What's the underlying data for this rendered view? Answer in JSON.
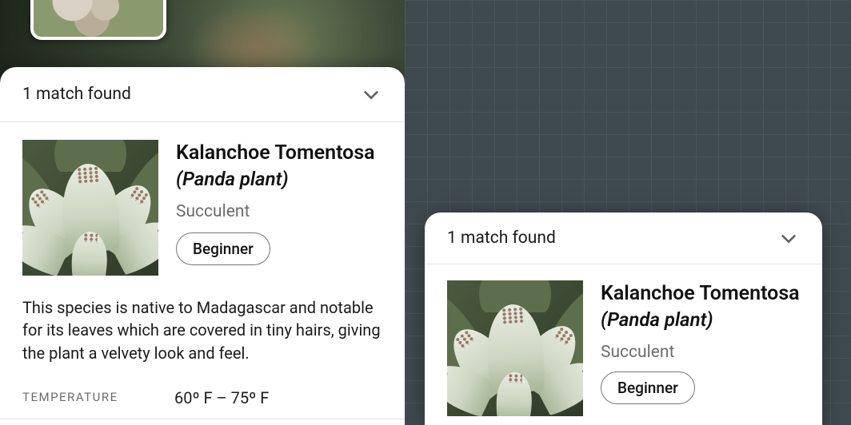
{
  "sheet": {
    "header": "1 match found",
    "result": {
      "scientific_name": "Kalanchoe Tomentosa",
      "common_name": "(Panda plant)",
      "category": "Succulent",
      "difficulty": "Beginner",
      "description": "This species is native to Madagascar and notable for its leaves which are covered in tiny hairs, giving the plant a velvety look and feel."
    },
    "specs": {
      "temperature_label": "TEMPERATURE",
      "temperature_value": "60º F – 75º F"
    }
  },
  "canvas": {
    "header": "1 match found",
    "result": {
      "scientific_name": "Kalanchoe Tomentosa",
      "common_name": "(Panda plant)",
      "category": "Succulent",
      "difficulty": "Beginner"
    }
  }
}
